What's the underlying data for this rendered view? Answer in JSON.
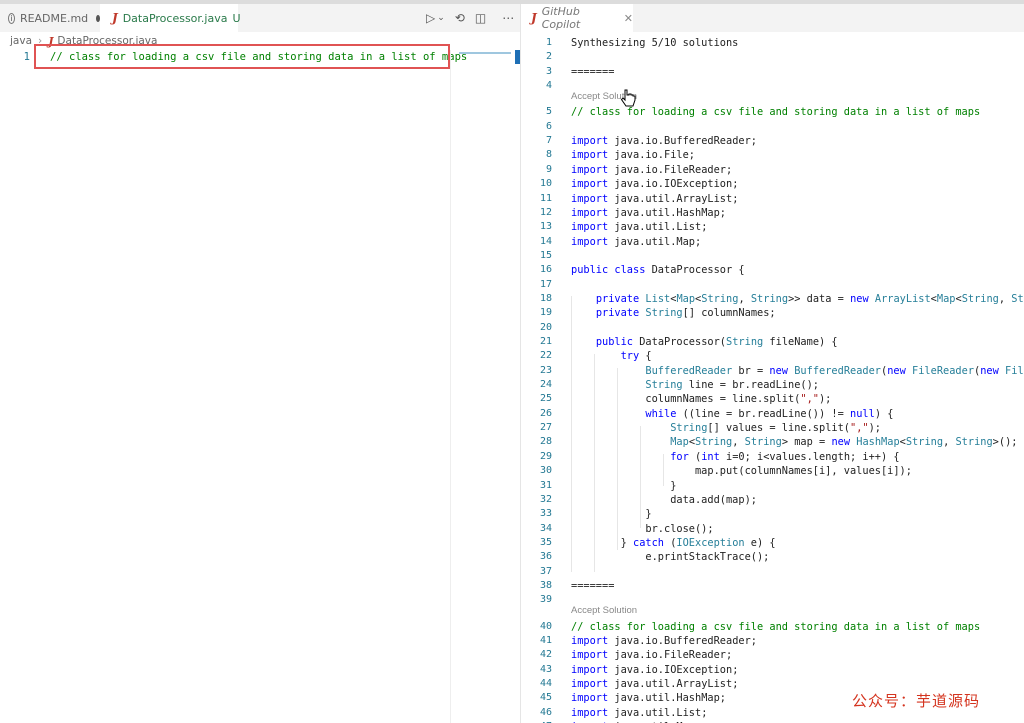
{
  "tabs_left": [
    {
      "name": "README.md"
    },
    {
      "name": "DataProcessor.java",
      "status": "U"
    }
  ],
  "tab_right": {
    "name": "GitHub Copilot"
  },
  "breadcrumb": [
    "java",
    "DataProcessor.java"
  ],
  "left_editor": {
    "lines": [
      {
        "num": "1",
        "text": "// class for loading a csv file and storing data in a list of maps"
      }
    ]
  },
  "copilot": {
    "accept_label": "Accept Solution",
    "rows": [
      {
        "n": "1",
        "t": "Synthesizing 5/10 solutions"
      },
      {
        "n": "2",
        "t": ""
      },
      {
        "n": "3",
        "t": "======="
      },
      {
        "n": "4",
        "t": ""
      },
      {
        "n": "5",
        "t": "// class for loading a csv file and storing data in a list of maps"
      },
      {
        "n": "6",
        "t": ""
      },
      {
        "n": "7",
        "t": "import java.io.BufferedReader;"
      },
      {
        "n": "8",
        "t": "import java.io.File;"
      },
      {
        "n": "9",
        "t": "import java.io.FileReader;"
      },
      {
        "n": "10",
        "t": "import java.io.IOException;"
      },
      {
        "n": "11",
        "t": "import java.util.ArrayList;"
      },
      {
        "n": "12",
        "t": "import java.util.HashMap;"
      },
      {
        "n": "13",
        "t": "import java.util.List;"
      },
      {
        "n": "14",
        "t": "import java.util.Map;"
      },
      {
        "n": "15",
        "t": ""
      },
      {
        "n": "16",
        "t": "public class DataProcessor {"
      },
      {
        "n": "17",
        "t": ""
      },
      {
        "n": "18",
        "t": "    private List<Map<String, String>> data = new ArrayList<Map<String, String>>();"
      },
      {
        "n": "19",
        "t": "    private String[] columnNames;"
      },
      {
        "n": "20",
        "t": ""
      },
      {
        "n": "21",
        "t": "    public DataProcessor(String fileName) {"
      },
      {
        "n": "22",
        "t": "        try {"
      },
      {
        "n": "23",
        "t": "            BufferedReader br = new BufferedReader(new FileReader(new File(fileName)));"
      },
      {
        "n": "24",
        "t": "            String line = br.readLine();"
      },
      {
        "n": "25",
        "t": "            columnNames = line.split(\",\");"
      },
      {
        "n": "26",
        "t": "            while ((line = br.readLine()) != null) {"
      },
      {
        "n": "27",
        "t": "                String[] values = line.split(\",\");"
      },
      {
        "n": "28",
        "t": "                Map<String, String> map = new HashMap<String, String>();"
      },
      {
        "n": "29",
        "t": "                for (int i=0; i<values.length; i++) {"
      },
      {
        "n": "30",
        "t": "                    map.put(columnNames[i], values[i]);"
      },
      {
        "n": "31",
        "t": "                }"
      },
      {
        "n": "32",
        "t": "                data.add(map);"
      },
      {
        "n": "33",
        "t": "            }"
      },
      {
        "n": "34",
        "t": "            br.close();"
      },
      {
        "n": "35",
        "t": "        } catch (IOException e) {"
      },
      {
        "n": "36",
        "t": "            e.printStackTrace();"
      },
      {
        "n": "37",
        "t": ""
      },
      {
        "n": "38",
        "t": "======="
      },
      {
        "n": "39",
        "t": ""
      },
      {
        "n": "40",
        "t": "// class for loading a csv file and storing data in a list of maps"
      },
      {
        "n": "41",
        "t": "import java.io.BufferedReader;"
      },
      {
        "n": "42",
        "t": "import java.io.FileReader;"
      },
      {
        "n": "43",
        "t": "import java.io.IOException;"
      },
      {
        "n": "44",
        "t": "import java.util.ArrayList;"
      },
      {
        "n": "45",
        "t": "import java.util.HashMap;"
      },
      {
        "n": "46",
        "t": "import java.util.List;"
      },
      {
        "n": "47",
        "t": "import java.util.Map;"
      }
    ]
  },
  "watermark": "公众号：芋道源码",
  "colors": {
    "comment": "#008000",
    "keyword": "#0000ff",
    "type": "#267f99",
    "line_number": "#237893",
    "highlight_box": "#e05353"
  }
}
